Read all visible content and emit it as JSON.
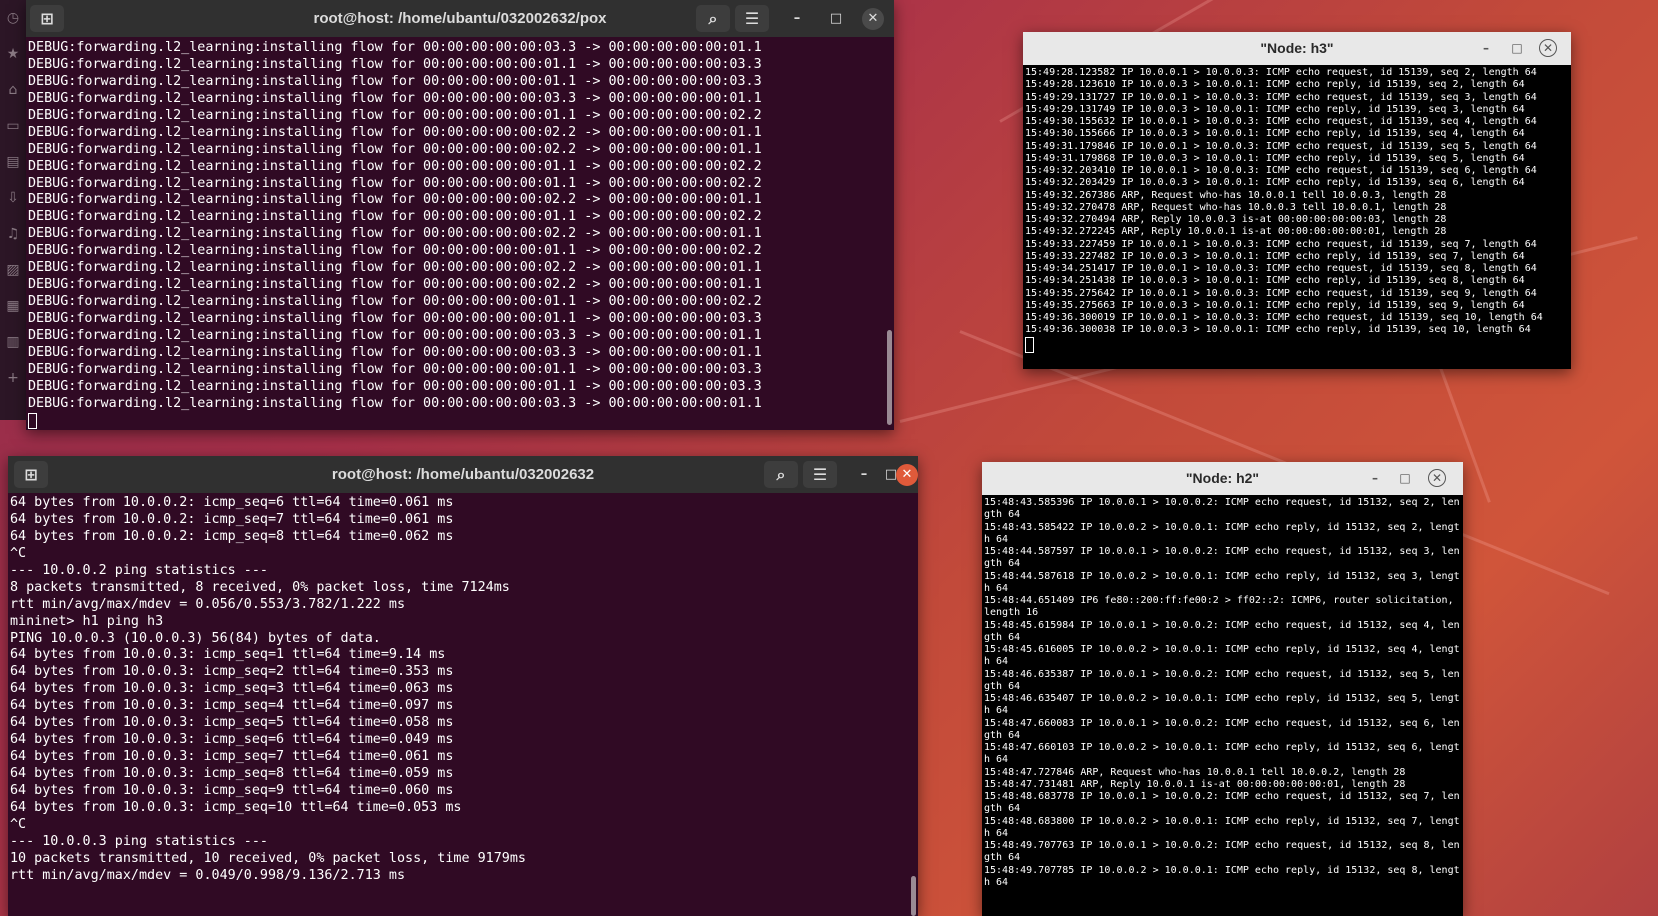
{
  "dock": {
    "icons": [
      "clock-icon",
      "star-icon",
      "home-icon",
      "sidebar-icon",
      "document-icon",
      "download-icon",
      "music-icon",
      "image-icon",
      "video-icon",
      "trash-icon",
      "plus-icon"
    ]
  },
  "pox_window": {
    "title": "root@host: /home/ubantu/032002632/pox",
    "lines": [
      "DEBUG:forwarding.l2_learning:installing flow for 00:00:00:00:00:03.3 -> 00:00:00:00:00:01.1",
      "DEBUG:forwarding.l2_learning:installing flow for 00:00:00:00:00:01.1 -> 00:00:00:00:00:03.3",
      "DEBUG:forwarding.l2_learning:installing flow for 00:00:00:00:00:01.1 -> 00:00:00:00:00:03.3",
      "DEBUG:forwarding.l2_learning:installing flow for 00:00:00:00:00:03.3 -> 00:00:00:00:00:01.1",
      "DEBUG:forwarding.l2_learning:installing flow for 00:00:00:00:00:01.1 -> 00:00:00:00:00:02.2",
      "DEBUG:forwarding.l2_learning:installing flow for 00:00:00:00:00:02.2 -> 00:00:00:00:00:01.1",
      "DEBUG:forwarding.l2_learning:installing flow for 00:00:00:00:00:02.2 -> 00:00:00:00:00:01.1",
      "DEBUG:forwarding.l2_learning:installing flow for 00:00:00:00:00:01.1 -> 00:00:00:00:00:02.2",
      "DEBUG:forwarding.l2_learning:installing flow for 00:00:00:00:00:01.1 -> 00:00:00:00:00:02.2",
      "DEBUG:forwarding.l2_learning:installing flow for 00:00:00:00:00:02.2 -> 00:00:00:00:00:01.1",
      "DEBUG:forwarding.l2_learning:installing flow for 00:00:00:00:00:01.1 -> 00:00:00:00:00:02.2",
      "DEBUG:forwarding.l2_learning:installing flow for 00:00:00:00:00:02.2 -> 00:00:00:00:00:01.1",
      "DEBUG:forwarding.l2_learning:installing flow for 00:00:00:00:00:01.1 -> 00:00:00:00:00:02.2",
      "DEBUG:forwarding.l2_learning:installing flow for 00:00:00:00:00:02.2 -> 00:00:00:00:00:01.1",
      "DEBUG:forwarding.l2_learning:installing flow for 00:00:00:00:00:02.2 -> 00:00:00:00:00:01.1",
      "DEBUG:forwarding.l2_learning:installing flow for 00:00:00:00:00:01.1 -> 00:00:00:00:00:02.2",
      "DEBUG:forwarding.l2_learning:installing flow for 00:00:00:00:00:01.1 -> 00:00:00:00:00:03.3",
      "DEBUG:forwarding.l2_learning:installing flow for 00:00:00:00:00:03.3 -> 00:00:00:00:00:01.1",
      "DEBUG:forwarding.l2_learning:installing flow for 00:00:00:00:00:03.3 -> 00:00:00:00:00:01.1",
      "DEBUG:forwarding.l2_learning:installing flow for 00:00:00:00:00:01.1 -> 00:00:00:00:00:03.3",
      "DEBUG:forwarding.l2_learning:installing flow for 00:00:00:00:00:01.1 -> 00:00:00:00:00:03.3",
      "DEBUG:forwarding.l2_learning:installing flow for 00:00:00:00:00:03.3 -> 00:00:00:00:00:01.1"
    ]
  },
  "mininet_window": {
    "title": "root@host: /home/ubantu/032002632",
    "lines": [
      "64 bytes from 10.0.0.2: icmp_seq=6 ttl=64 time=0.061 ms",
      "64 bytes from 10.0.0.2: icmp_seq=7 ttl=64 time=0.061 ms",
      "64 bytes from 10.0.0.2: icmp_seq=8 ttl=64 time=0.062 ms",
      "^C",
      "--- 10.0.0.2 ping statistics ---",
      "8 packets transmitted, 8 received, 0% packet loss, time 7124ms",
      "rtt min/avg/max/mdev = 0.056/0.553/3.782/1.222 ms",
      "mininet> h1 ping h3",
      "PING 10.0.0.3 (10.0.0.3) 56(84) bytes of data.",
      "64 bytes from 10.0.0.3: icmp_seq=1 ttl=64 time=9.14 ms",
      "64 bytes from 10.0.0.3: icmp_seq=2 ttl=64 time=0.353 ms",
      "64 bytes from 10.0.0.3: icmp_seq=3 ttl=64 time=0.063 ms",
      "64 bytes from 10.0.0.3: icmp_seq=4 ttl=64 time=0.097 ms",
      "64 bytes from 10.0.0.3: icmp_seq=5 ttl=64 time=0.058 ms",
      "64 bytes from 10.0.0.3: icmp_seq=6 ttl=64 time=0.049 ms",
      "64 bytes from 10.0.0.3: icmp_seq=7 ttl=64 time=0.061 ms",
      "64 bytes from 10.0.0.3: icmp_seq=8 ttl=64 time=0.059 ms",
      "64 bytes from 10.0.0.3: icmp_seq=9 ttl=64 time=0.060 ms",
      "64 bytes from 10.0.0.3: icmp_seq=10 ttl=64 time=0.053 ms",
      "^C",
      "--- 10.0.0.3 ping statistics ---",
      "10 packets transmitted, 10 received, 0% packet loss, time 9179ms",
      "rtt min/avg/max/mdev = 0.049/0.998/9.136/2.713 ms"
    ]
  },
  "h3_window": {
    "title": "\"Node: h3\"",
    "lines": [
      "15:49:28.123582 IP 10.0.0.1 > 10.0.0.3: ICMP echo request, id 15139, seq 2, length 64",
      "15:49:28.123610 IP 10.0.0.3 > 10.0.0.1: ICMP echo reply, id 15139, seq 2, length 64",
      "15:49:29.131727 IP 10.0.0.1 > 10.0.0.3: ICMP echo request, id 15139, seq 3, length 64",
      "15:49:29.131749 IP 10.0.0.3 > 10.0.0.1: ICMP echo reply, id 15139, seq 3, length 64",
      "15:49:30.155632 IP 10.0.0.1 > 10.0.0.3: ICMP echo request, id 15139, seq 4, length 64",
      "15:49:30.155666 IP 10.0.0.3 > 10.0.0.1: ICMP echo reply, id 15139, seq 4, length 64",
      "15:49:31.179846 IP 10.0.0.1 > 10.0.0.3: ICMP echo request, id 15139, seq 5, length 64",
      "15:49:31.179868 IP 10.0.0.3 > 10.0.0.1: ICMP echo reply, id 15139, seq 5, length 64",
      "15:49:32.203410 IP 10.0.0.1 > 10.0.0.3: ICMP echo request, id 15139, seq 6, length 64",
      "15:49:32.203429 IP 10.0.0.3 > 10.0.0.1: ICMP echo reply, id 15139, seq 6, length 64",
      "15:49:32.267386 ARP, Request who-has 10.0.0.1 tell 10.0.0.3, length 28",
      "15:49:32.270478 ARP, Request who-has 10.0.0.3 tell 10.0.0.1, length 28",
      "15:49:32.270494 ARP, Reply 10.0.0.3 is-at 00:00:00:00:00:03, length 28",
      "15:49:32.272245 ARP, Reply 10.0.0.1 is-at 00:00:00:00:00:01, length 28",
      "15:49:33.227459 IP 10.0.0.1 > 10.0.0.3: ICMP echo request, id 15139, seq 7, length 64",
      "15:49:33.227482 IP 10.0.0.3 > 10.0.0.1: ICMP echo reply, id 15139, seq 7, length 64",
      "15:49:34.251417 IP 10.0.0.1 > 10.0.0.3: ICMP echo request, id 15139, seq 8, length 64",
      "15:49:34.251438 IP 10.0.0.3 > 10.0.0.1: ICMP echo reply, id 15139, seq 8, length 64",
      "15:49:35.275642 IP 10.0.0.1 > 10.0.0.3: ICMP echo request, id 15139, seq 9, length 64",
      "15:49:35.275663 IP 10.0.0.3 > 10.0.0.1: ICMP echo reply, id 15139, seq 9, length 64",
      "15:49:36.300019 IP 10.0.0.1 > 10.0.0.3: ICMP echo request, id 15139, seq 10, length 64",
      "15:49:36.300038 IP 10.0.0.3 > 10.0.0.1: ICMP echo reply, id 15139, seq 10, length 64"
    ]
  },
  "h2_window": {
    "title": "\"Node: h2\"",
    "lines": [
      "15:48:43.585396 IP 10.0.0.1 > 10.0.0.2: ICMP echo request, id 15132, seq 2, length 64",
      "15:48:43.585422 IP 10.0.0.2 > 10.0.0.1: ICMP echo reply, id 15132, seq 2, length 64",
      "15:48:44.587597 IP 10.0.0.1 > 10.0.0.2: ICMP echo request, id 15132, seq 3, length 64",
      "15:48:44.587618 IP 10.0.0.2 > 10.0.0.1: ICMP echo reply, id 15132, seq 3, length 64",
      "15:48:44.651409 IP6 fe80::200:ff:fe00:2 > ff02::2: ICMP6, router solicitation, length 16",
      "15:48:45.615984 IP 10.0.0.1 > 10.0.0.2: ICMP echo request, id 15132, seq 4, length 64",
      "15:48:45.616005 IP 10.0.0.2 > 10.0.0.1: ICMP echo reply, id 15132, seq 4, length 64",
      "15:48:46.635387 IP 10.0.0.1 > 10.0.0.2: ICMP echo request, id 15132, seq 5, length 64",
      "15:48:46.635407 IP 10.0.0.2 > 10.0.0.1: ICMP echo reply, id 15132, seq 5, length 64",
      "15:48:47.660083 IP 10.0.0.1 > 10.0.0.2: ICMP echo request, id 15132, seq 6, length 64",
      "15:48:47.660103 IP 10.0.0.2 > 10.0.0.1: ICMP echo reply, id 15132, seq 6, length 64",
      "15:48:47.727846 ARP, Request who-has 10.0.0.1 tell 10.0.0.2, length 28",
      "15:48:47.731481 ARP, Reply 10.0.0.1 is-at 00:00:00:00:00:01, length 28",
      "15:48:48.683778 IP 10.0.0.1 > 10.0.0.2: ICMP echo request, id 15132, seq 7, length 64",
      "15:48:48.683800 IP 10.0.0.2 > 10.0.0.1: ICMP echo reply, id 15132, seq 7, length 64",
      "15:48:49.707763 IP 10.0.0.1 > 10.0.0.2: ICMP echo request, id 15132, seq 8, length 64",
      "15:48:49.707785 IP 10.0.0.2 > 10.0.0.1: ICMP echo reply, id 15132, seq 8, length 64"
    ]
  },
  "colors": {
    "terminal_bg": "#300a24",
    "xterm_bg": "#000000",
    "close_active": "#e05a3a"
  }
}
